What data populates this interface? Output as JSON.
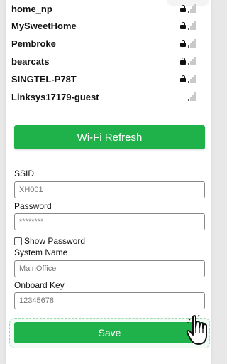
{
  "networks": [
    {
      "name": "home_np",
      "secured": true,
      "signal": 1
    },
    {
      "name": "MySweetHome",
      "secured": true,
      "signal": 1
    },
    {
      "name": "Pembroke",
      "secured": true,
      "signal": 1
    },
    {
      "name": "bearcats",
      "secured": true,
      "signal": 1
    },
    {
      "name": "SINGTEL-P78T",
      "secured": true,
      "signal": 1
    },
    {
      "name": "Linksys17179-guest",
      "secured": false,
      "signal": 1
    }
  ],
  "refresh_button": {
    "label": "Wi-Fi Refresh"
  },
  "form": {
    "ssid_label": "SSID",
    "ssid_value": "XH001",
    "password_label": "Password",
    "password_value": "********",
    "show_password_label": "Show Password",
    "system_name_label": "System Name",
    "system_name_value": "MainOffice",
    "onboard_key_label": "Onboard Key",
    "onboard_key_value": "12345678"
  },
  "save_button": {
    "label": "Save"
  },
  "colors": {
    "accent": "#1fb14a",
    "highlight_border": "#9ed8ad"
  },
  "icons": {
    "lock": "lock-icon",
    "signal": "wifi-signal-icon",
    "cursor": "hand-pointer-icon"
  }
}
